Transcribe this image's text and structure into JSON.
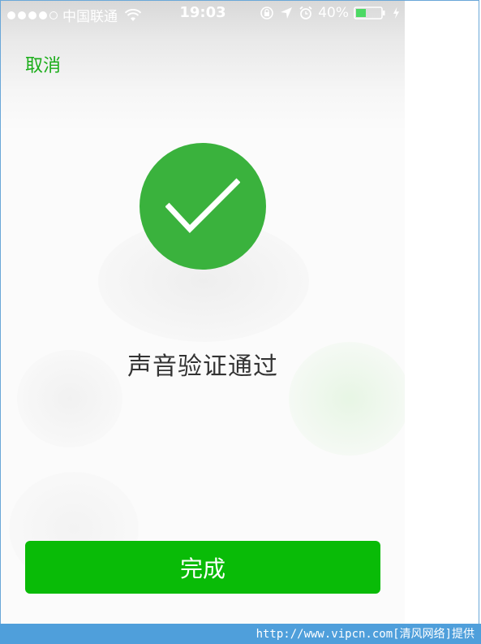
{
  "status_bar": {
    "carrier": "中国联通",
    "time": "19:03",
    "battery_percent": "40%",
    "battery_level": 0.4,
    "signal_bars": 4,
    "signal_total": 5,
    "icons": [
      "wifi-icon",
      "rotation-lock-icon",
      "location-arrow-icon",
      "alarm-icon",
      "battery-icon",
      "charging-bolt-icon"
    ]
  },
  "nav": {
    "cancel_label": "取消"
  },
  "result": {
    "icon": "checkmark-icon",
    "message": "声音验证通过"
  },
  "actions": {
    "done_label": "完成"
  },
  "footer": {
    "text": "http://www.vipcn.com[清风网络]提供"
  },
  "colors": {
    "accent_green": "#1aad19",
    "success_circle": "#3ab23d",
    "button_green": "#09bb07",
    "footer_blue": "#4f9fdb"
  }
}
